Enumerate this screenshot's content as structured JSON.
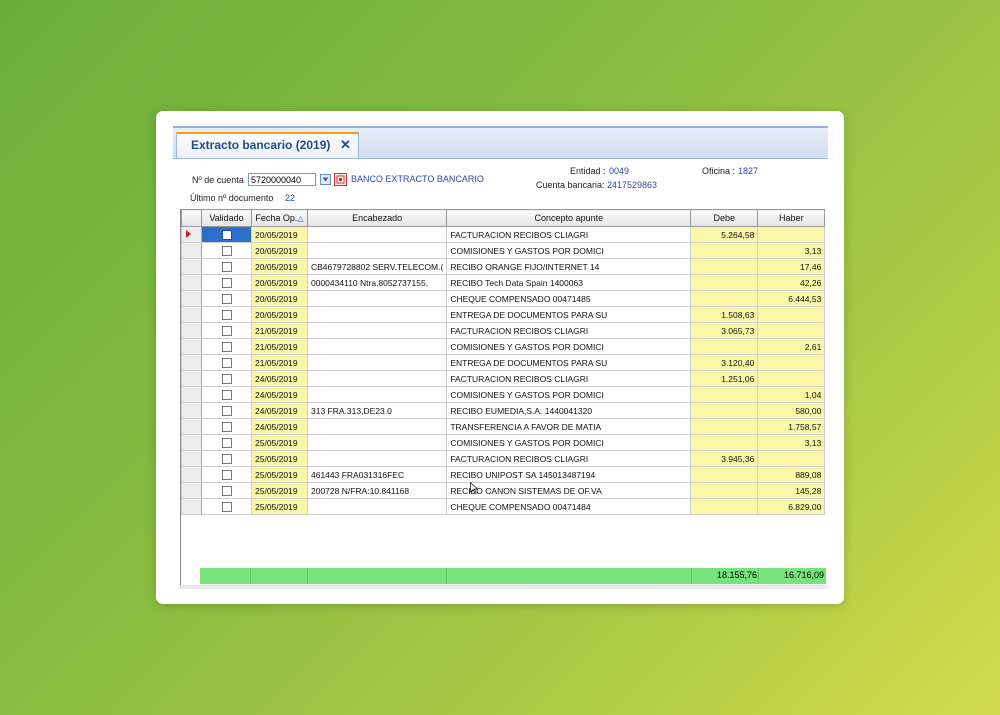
{
  "tab": {
    "title": "Extracto bancario  (2019)",
    "close": "✕"
  },
  "account": {
    "label": "Nº de cuenta",
    "value": "5720000040",
    "name": "BANCO EXTRACTO BANCARIO",
    "last_doc_label": "Último nº documento",
    "last_doc_value": "22",
    "entidad_label": "Entidad :",
    "entidad_value": "0049",
    "cuenta_label": "Cuenta bancaria:",
    "cuenta_value": "2417529863",
    "oficina_label": "Oficina :",
    "oficina_value": "1827"
  },
  "columns": {
    "validado": "Validado",
    "fecha": "Fecha Op.",
    "encabezado": "Encabezado",
    "concepto": "Concepto apunte",
    "debe": "Debe",
    "haber": "Haber"
  },
  "rows": [
    {
      "fecha": "20/05/2019",
      "enc": "",
      "concepto": "FACTURACION RECIBOS CLIAGRI",
      "debe": "5.264,58",
      "haber": ""
    },
    {
      "fecha": "20/05/2019",
      "enc": "",
      "concepto": "COMISIONES Y GASTOS POR DOMICI",
      "debe": "",
      "haber": "3,13"
    },
    {
      "fecha": "20/05/2019",
      "enc": "CB4679728802 SERV.TELECOM.(",
      "concepto": "RECIBO ORANGE FIJO/INTERNET 14",
      "debe": "",
      "haber": "17,46"
    },
    {
      "fecha": "20/05/2019",
      "enc": "0000434110 Ntra.8052737155,",
      "concepto": "RECIBO Tech Data Spain 1400063",
      "debe": "",
      "haber": "42,26"
    },
    {
      "fecha": "20/05/2019",
      "enc": "",
      "concepto": "CHEQUE COMPENSADO 00471485",
      "debe": "",
      "haber": "6.444,53"
    },
    {
      "fecha": "20/05/2019",
      "enc": "",
      "concepto": "ENTREGA DE DOCUMENTOS PARA SU",
      "debe": "1.508,63",
      "haber": ""
    },
    {
      "fecha": "21/05/2019",
      "enc": "",
      "concepto": "FACTURACION RECIBOS CLIAGRI",
      "debe": "3.065,73",
      "haber": ""
    },
    {
      "fecha": "21/05/2019",
      "enc": "",
      "concepto": "COMISIONES Y GASTOS POR DOMICI",
      "debe": "",
      "haber": "2,61"
    },
    {
      "fecha": "21/05/2019",
      "enc": "",
      "concepto": "ENTREGA DE DOCUMENTOS PARA SU",
      "debe": "3.120,40",
      "haber": ""
    },
    {
      "fecha": "24/05/2019",
      "enc": "",
      "concepto": "FACTURACION RECIBOS CLIAGRI",
      "debe": "1.251,06",
      "haber": ""
    },
    {
      "fecha": "24/05/2019",
      "enc": "",
      "concepto": "COMISIONES Y GASTOS POR DOMICI",
      "debe": "",
      "haber": "1,04"
    },
    {
      "fecha": "24/05/2019",
      "enc": "313 FRA.313,DE23.0",
      "concepto": "RECIBO EUMEDIA,S.A. 1440041320",
      "debe": "",
      "haber": "580,00"
    },
    {
      "fecha": "24/05/2019",
      "enc": "",
      "concepto": "TRANSFERENCIA A FAVOR DE MATIA",
      "debe": "",
      "haber": "1.758,57"
    },
    {
      "fecha": "25/05/2019",
      "enc": "",
      "concepto": "COMISIONES Y GASTOS POR DOMICI",
      "debe": "",
      "haber": "3,13"
    },
    {
      "fecha": "25/05/2019",
      "enc": "",
      "concepto": "FACTURACION RECIBOS CLIAGRI",
      "debe": "3.945,36",
      "haber": ""
    },
    {
      "fecha": "25/05/2019",
      "enc": "461443 FRA031316FEC",
      "concepto": "RECIBO UNIPOST SA 145013487194",
      "debe": "",
      "haber": "889,08"
    },
    {
      "fecha": "25/05/2019",
      "enc": "200728 N/FRA:10.841168",
      "concepto": "RECIBO CANON SISTEMAS DE OF.VA",
      "debe": "",
      "haber": "145,28"
    },
    {
      "fecha": "25/05/2019",
      "enc": "",
      "concepto": "CHEQUE COMPENSADO 00471484",
      "debe": "",
      "haber": "6.829,00"
    }
  ],
  "totals": {
    "debe": "18.155,76",
    "haber": "16.716,09"
  },
  "icons": {
    "sort": "sort-asc-icon",
    "row_pointer": "row-pointer-icon"
  },
  "colors": {
    "yellow_cell": "#fbf7a8",
    "totals_green": "#77e37c",
    "tab_accent": "#f39c12"
  }
}
